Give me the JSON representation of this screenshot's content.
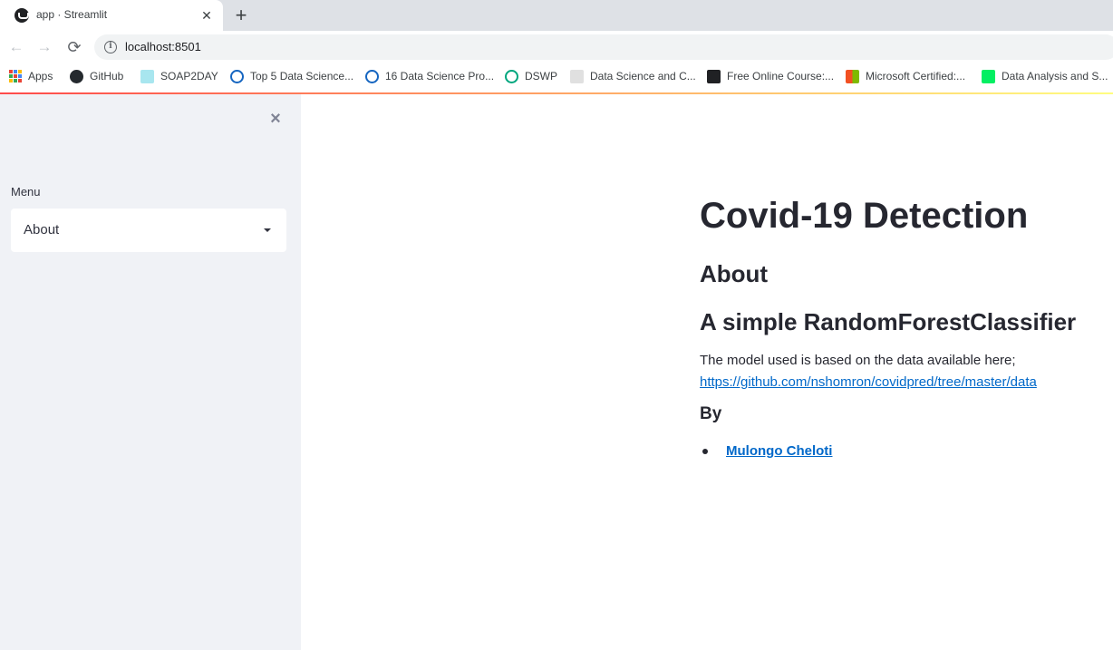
{
  "browser": {
    "tab": {
      "title": "app · Streamlit",
      "close_glyph": "✕"
    },
    "new_tab_glyph": "+",
    "nav": {
      "back_glyph": "←",
      "forward_glyph": "→",
      "reload_glyph": "⟳"
    },
    "url": "localhost:8501",
    "bookmarks": [
      {
        "label": "Apps",
        "icon": "apps-grid-icon",
        "color": "#1a73e8"
      },
      {
        "label": "GitHub",
        "icon": "github-icon",
        "color": "#24292e"
      },
      {
        "label": "SOAP2DAY",
        "icon": "soap2day-icon",
        "color": "#a8e6ef"
      },
      {
        "label": "Top 5 Data Science...",
        "icon": "site-icon",
        "color": "#1565c0"
      },
      {
        "label": "16 Data Science Pro...",
        "icon": "site-icon",
        "color": "#1565c0"
      },
      {
        "label": "DSWP",
        "icon": "dswp-icon",
        "color": "#00a67e"
      },
      {
        "label": "Data Science and C...",
        "icon": "site-icon",
        "color": "#9e9e9e"
      },
      {
        "label": "Free Online Course:...",
        "icon": "course-icon",
        "color": "#202124"
      },
      {
        "label": "Microsoft Certified:...",
        "icon": "microsoft-icon",
        "color": "#f25022"
      },
      {
        "label": "Data Analysis and S...",
        "icon": "datacamp-icon",
        "color": "#03ef62"
      }
    ]
  },
  "sidebar": {
    "close_glyph": "×",
    "menu_label": "Menu",
    "select_value": "About"
  },
  "main": {
    "title": "Covid-19 Detection",
    "section": "About",
    "subtitle": "A simple RandomForestClassifier",
    "description": "The model used is based on the data available here;",
    "data_link": "https://github.com/nshomron/covidpred/tree/master/data",
    "by_heading": "By",
    "authors": [
      "Mulongo Cheloti"
    ]
  },
  "colors": {
    "sidebar_bg": "#f0f2f6",
    "link": "#0068c9",
    "text": "#262730",
    "decoration_start": "#ff4b4b",
    "decoration_end": "#fffd80"
  }
}
